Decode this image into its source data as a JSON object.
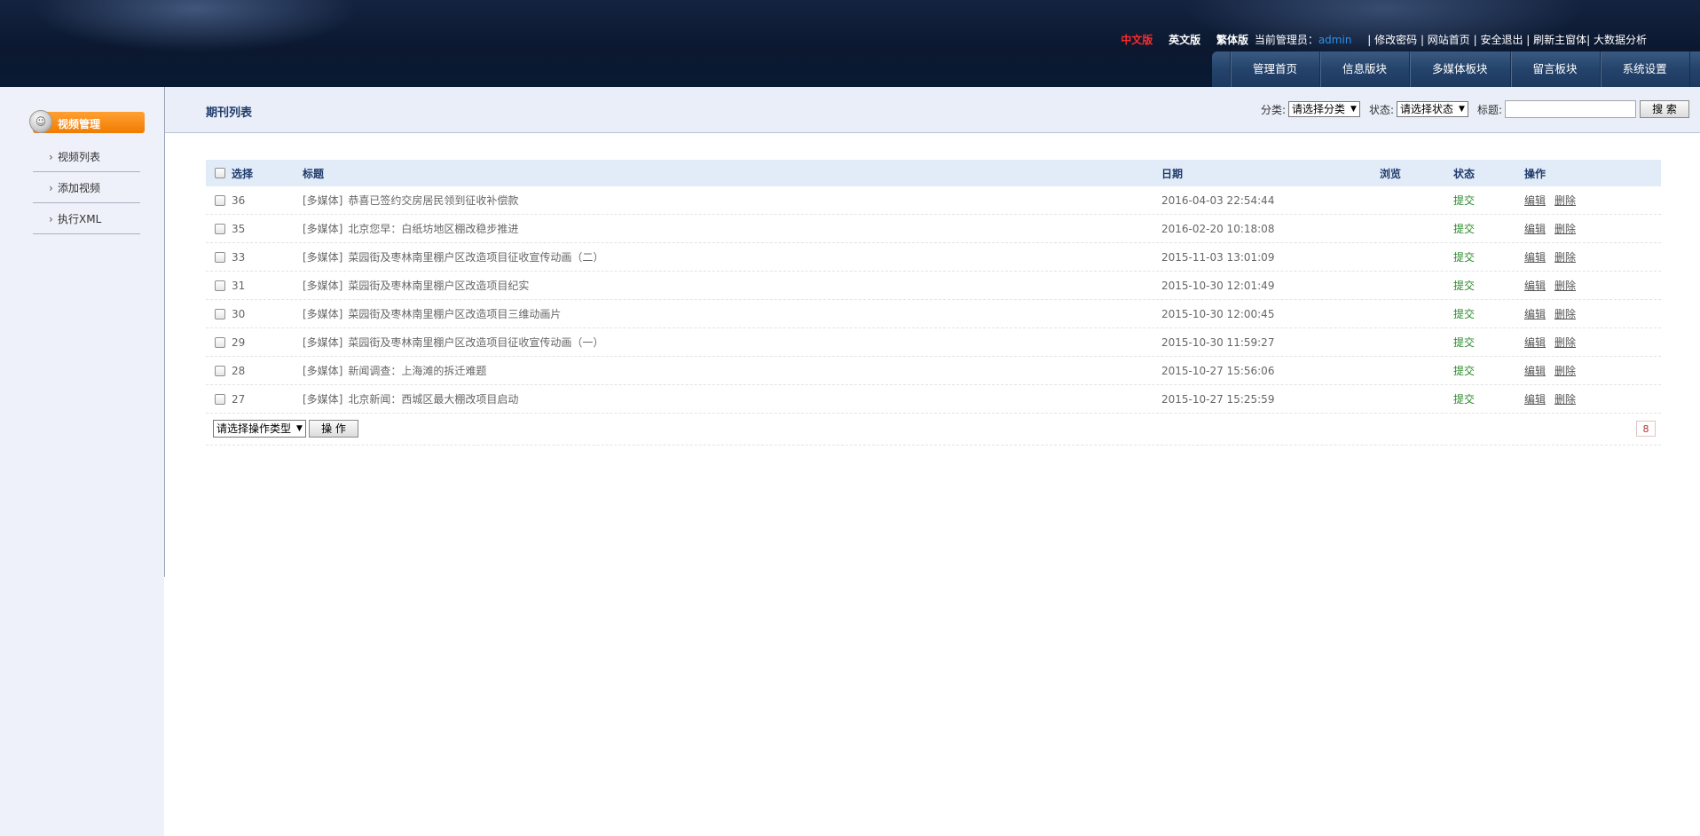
{
  "header": {
    "lang_links": [
      "中文版",
      "英文版",
      "繁体版"
    ],
    "admin_label": "当前管理员：",
    "admin_name": "admin",
    "links_text": "| 修改密码 | 网站首页 | 安全退出 | 刷新主窗体| 大数据分析",
    "nav": [
      "管理首页",
      "信息版块",
      "多媒体板块",
      "留言板块",
      "系统设置"
    ]
  },
  "sidebar": {
    "section_title": "视频管理",
    "items": [
      "视频列表",
      "添加视频",
      "执行XML"
    ]
  },
  "toolbar": {
    "title": "期刊列表",
    "category_label": "分类:",
    "category_value": "请选择分类",
    "status_label": "状态:",
    "status_value": "请选择状态",
    "title_label": "标题:",
    "search_value": "",
    "search_button": "搜 索"
  },
  "table": {
    "headers": {
      "select": "选择",
      "title": "标题",
      "date": "日期",
      "views": "浏览",
      "status": "状态",
      "ops": "操作"
    },
    "rows": [
      {
        "id": "36",
        "category": "[多媒体]",
        "title": "恭喜已签约交房居民领到征收补偿款",
        "date": "2016-04-03 22:54:44",
        "status": "提交"
      },
      {
        "id": "35",
        "category": "[多媒体]",
        "title": "北京您早：白纸坊地区棚改稳步推进",
        "date": "2016-02-20 10:18:08",
        "status": "提交"
      },
      {
        "id": "33",
        "category": "[多媒体]",
        "title": "菜园街及枣林南里棚户区改造项目征收宣传动画（二）",
        "date": "2015-11-03 13:01:09",
        "status": "提交"
      },
      {
        "id": "31",
        "category": "[多媒体]",
        "title": "菜园街及枣林南里棚户区改造项目纪实",
        "date": "2015-10-30 12:01:49",
        "status": "提交"
      },
      {
        "id": "30",
        "category": "[多媒体]",
        "title": "菜园街及枣林南里棚户区改造项目三维动画片",
        "date": "2015-10-30 12:00:45",
        "status": "提交"
      },
      {
        "id": "29",
        "category": "[多媒体]",
        "title": "菜园街及枣林南里棚户区改造项目征收宣传动画（一）",
        "date": "2015-10-30 11:59:27",
        "status": "提交"
      },
      {
        "id": "28",
        "category": "[多媒体]",
        "title": "新闻调查：上海滩的拆迁难题",
        "date": "2015-10-27 15:56:06",
        "status": "提交"
      },
      {
        "id": "27",
        "category": "[多媒体]",
        "title": "北京新闻：西城区最大棚改项目启动",
        "date": "2015-10-27 15:25:59",
        "status": "提交"
      }
    ],
    "edit_label": "编辑",
    "delete_label": "删除",
    "bulk_select_value": "请选择操作类型",
    "bulk_button": "操 作",
    "page_count": "8"
  },
  "colors": {
    "active_lang": "#ff2a2a",
    "admin_name": "#2f8fe6",
    "sidebar_header": "#f08a10",
    "status_green": "#2a8a2a",
    "title_blue": "#1f3b6b"
  }
}
